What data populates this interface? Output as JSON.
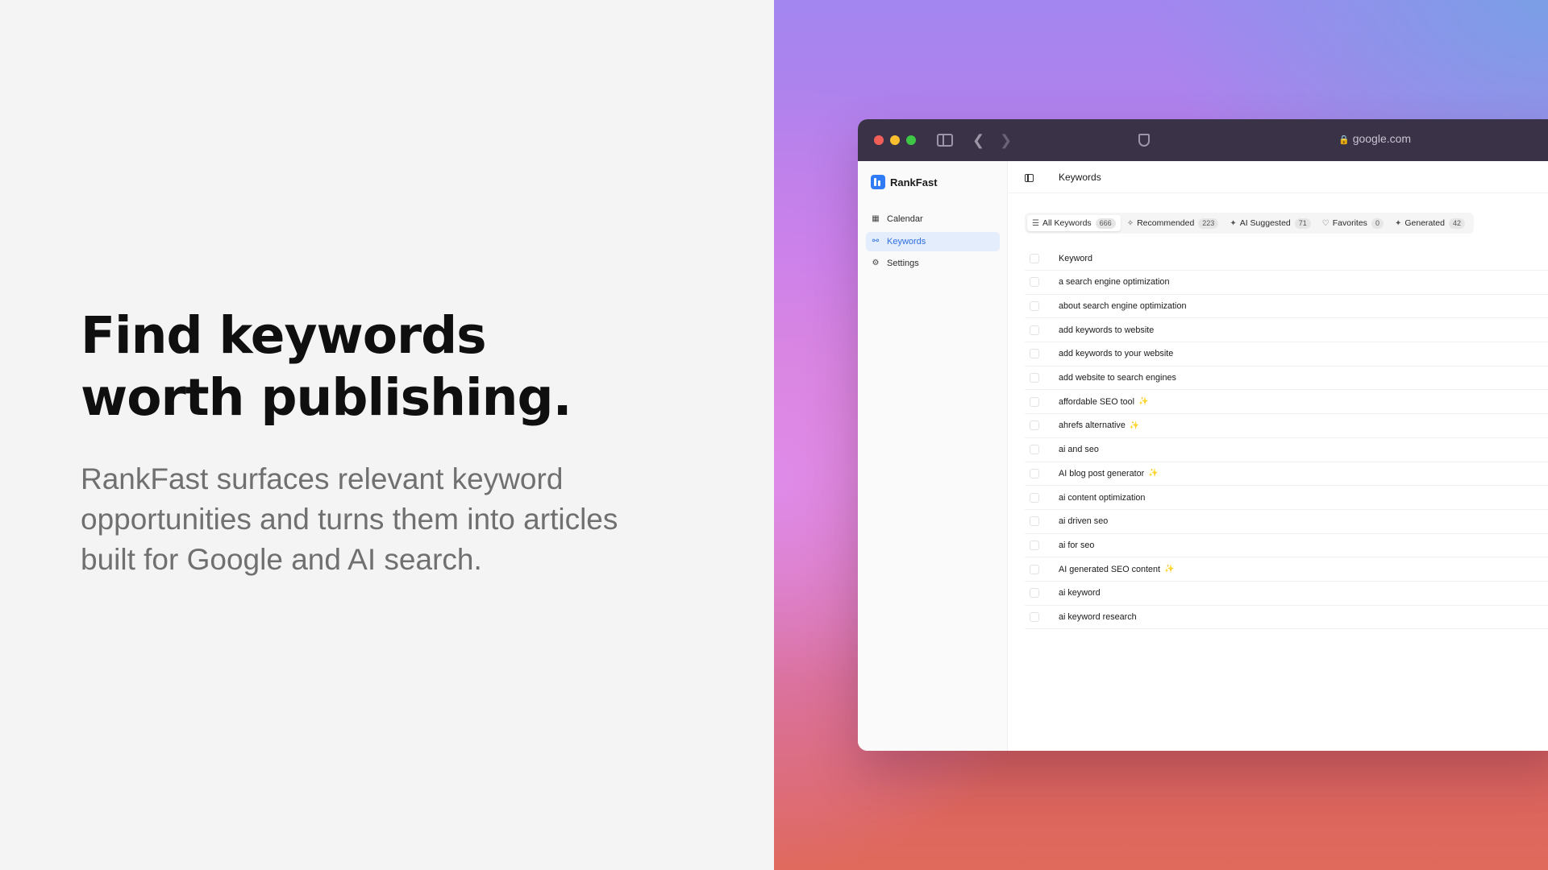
{
  "hero": {
    "headline_line1": "Find keywords",
    "headline_line2": "worth publishing.",
    "subcopy": "RankFast surfaces relevant keyword opportunities and turns them into articles built for Google and AI search."
  },
  "browser": {
    "url": "google.com"
  },
  "app": {
    "brand": "RankFast",
    "nav": [
      {
        "label": "Calendar",
        "icon": "calendar-icon",
        "active": false
      },
      {
        "label": "Keywords",
        "icon": "key-icon",
        "active": true
      },
      {
        "label": "Settings",
        "icon": "gear-icon",
        "active": false
      }
    ],
    "page_title": "Keywords",
    "tabs": [
      {
        "label": "All Keywords",
        "count": "666",
        "icon": "list-icon",
        "active": true
      },
      {
        "label": "Recommended",
        "count": "223",
        "icon": "sparkles-icon",
        "active": false
      },
      {
        "label": "AI Suggested",
        "count": "71",
        "icon": "magic-wand-icon",
        "active": false
      },
      {
        "label": "Favorites",
        "count": "0",
        "icon": "heart-icon",
        "active": false
      },
      {
        "label": "Generated",
        "count": "42",
        "icon": "magic-wand-icon",
        "active": false
      }
    ],
    "table": {
      "column_header": "Keyword",
      "rows": [
        {
          "keyword": "a search engine optimization",
          "sparkle": false
        },
        {
          "keyword": "about search engine optimization",
          "sparkle": false
        },
        {
          "keyword": "add keywords to website",
          "sparkle": false
        },
        {
          "keyword": "add keywords to your website",
          "sparkle": false
        },
        {
          "keyword": "add website to search engines",
          "sparkle": false
        },
        {
          "keyword": "affordable SEO tool",
          "sparkle": true
        },
        {
          "keyword": "ahrefs alternative",
          "sparkle": true
        },
        {
          "keyword": "ai and seo",
          "sparkle": false
        },
        {
          "keyword": "AI blog post generator",
          "sparkle": true
        },
        {
          "keyword": "ai content optimization",
          "sparkle": false
        },
        {
          "keyword": "ai driven seo",
          "sparkle": false
        },
        {
          "keyword": "ai for seo",
          "sparkle": false
        },
        {
          "keyword": "AI generated SEO content",
          "sparkle": true
        },
        {
          "keyword": "ai keyword",
          "sparkle": false
        },
        {
          "keyword": "ai keyword research",
          "sparkle": false
        }
      ]
    }
  },
  "colors": {
    "accent": "#2f7cf6",
    "sparkle": "#f0c330",
    "titlebar": "#3a3246"
  }
}
